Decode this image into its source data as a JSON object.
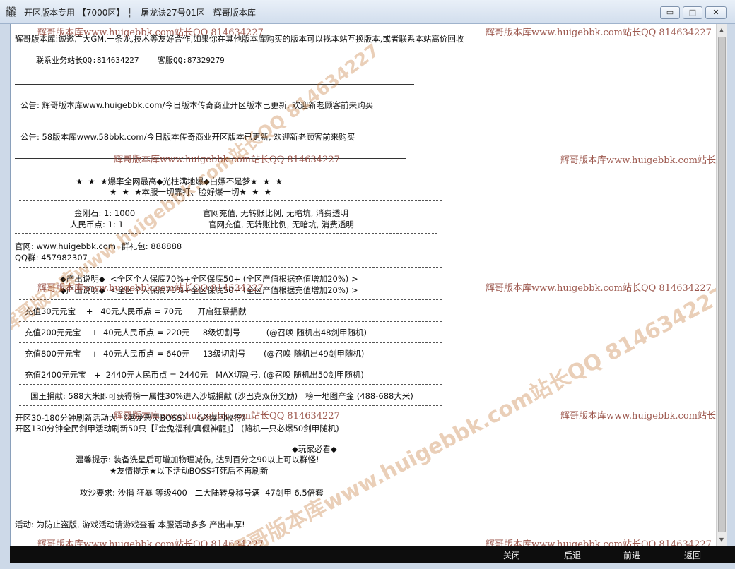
{
  "window": {
    "icon": "dragon-glyph-icon",
    "title": "开区版本专用 【7000区】 ┆ - 屠龙诀27号01区 - 辉哥版本库",
    "minimize": "▭",
    "maximize": "□",
    "close": "✕"
  },
  "watermark": {
    "text": "辉哥版本库www.huigebbk.com站长QQ 814634227",
    "right_text": "辉哥版本库www.huigebbk.com站长QQ",
    "big1": "辉哥版本库www.huigebbk.com站长QQ 814634227",
    "big2": "辉哥版本库www.huigebbk.com站长QQ 814634227"
  },
  "content": {
    "intro": "辉哥版本库:诚邀广大GM,一条龙,技术等友好合作,如果你在其他版本库购买的版本可以找本站互换版本,或者联系本站高价回收",
    "contact": "联系业务站长QQ:814634227    客服QQ:87329279",
    "notice1": "公告: 辉哥版本库www.huigebbk.com/今日版本传奇商业开区版本已更新, 欢迎新老顾客前来购买",
    "notice2": "公告: 58版本库www.58bbk.com/今日版本传奇商业开区版本已更新, 欢迎新老顾客前来购买",
    "star1": "★  ★  ★爆率全网最高◆光柱满地爆◆白嫖不是梦★  ★  ★",
    "star2": "★  ★  ★本服一切靠打、脸好爆一切★  ★  ★",
    "rate1_label": "金刚石: 1: 1000",
    "rate1_desc": "官网充值, 无转账比例, 无暗坑, 消费透明",
    "rate2_label": "人民币点: 1: 1",
    "rate2_desc": "官网充值, 无转账比例, 无暗坑, 消费透明",
    "website": "官网: www.huigebbk.com  群礼包: 888888",
    "qq_group": "QQ群: 457982307",
    "output1": "◆产出说明◆  <全区个人保底70%+全区保底50+ (全区产值根据充值增加20%) >",
    "output2": "◆产出说明◆  <全区个人保底70%+全区保底50+ (全区产值根据充值增加20%) >",
    "recharge1": "充值30元元宝    +   40元人民币点 = 70元      开启狂暴捐献",
    "recharge2": "充值200元元宝    +  40元人民币点 = 220元     8级切割号          (@召唤 随机出48剑甲随机)",
    "recharge3": "充值800元元宝    +  40元人民币点 = 640元     13级切割号       (@召唤 随机出49剑甲随机)",
    "recharge4": "充值2400元元宝   +  2440元人民币点 = 2440元   MAX切割号. (@召唤 随机出50剑甲随机)",
    "king": "国王捐献: 588大米即可获得榜一属性30%进入沙城捐献 (沙巴克双份奖励)   榜一地图产金 (488-688大米)",
    "event1": "开区30-180分钟刷新活动大 《屠龙恶灵BOSS》 《必爆回收符》",
    "event2": "开区130分钟全民剑甲活动刷新50只【『金兔福利/真假神龍』】 (随机一只必爆50剑甲随机)",
    "must_see": "◆玩家必看◆",
    "tip": "温馨提示: 装备洗星后可增加物理减伤, 达到百分之90以上可以群怪!",
    "friendly": "★友情提示★以下活动BOSS打死后不再刷新",
    "siege": "攻沙要求: 沙捐 狂暴 等级400   二大陆转身称号满  47剑甲 6.5倍套",
    "activity": "活动: 为防止盗版, 游戏活动请游戏查看 本服活动多多 产出丰厚!"
  },
  "bottom": {
    "close": "关闭",
    "back": "后退",
    "forward": "前进",
    "return": "返回"
  }
}
